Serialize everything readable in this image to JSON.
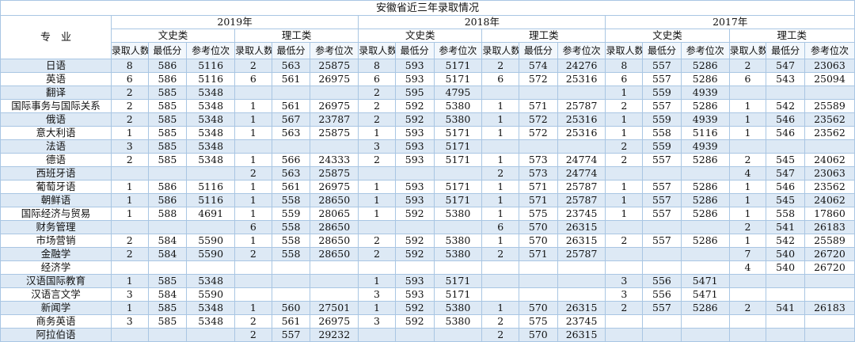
{
  "title": "安徽省近三年录取情况",
  "major_header": "专　业",
  "years": [
    "2019年",
    "2018年",
    "2017年"
  ],
  "tracks": [
    "文史类",
    "理工类"
  ],
  "metrics": [
    "录取人数",
    "最低分",
    "参考位次"
  ],
  "rows": [
    {
      "major": "日语",
      "v": [
        "8",
        "586",
        "5116",
        "2",
        "563",
        "25875",
        "8",
        "593",
        "5171",
        "2",
        "574",
        "24276",
        "8",
        "557",
        "5286",
        "2",
        "547",
        "23063"
      ]
    },
    {
      "major": "英语",
      "v": [
        "6",
        "586",
        "5116",
        "6",
        "561",
        "26975",
        "6",
        "593",
        "5171",
        "6",
        "572",
        "25316",
        "6",
        "557",
        "5286",
        "6",
        "543",
        "25094"
      ]
    },
    {
      "major": "翻译",
      "v": [
        "2",
        "585",
        "5348",
        "",
        "",
        "",
        "2",
        "595",
        "4795",
        "",
        "",
        "",
        "1",
        "559",
        "4939",
        "",
        "",
        ""
      ]
    },
    {
      "major": "国际事务与国际关系",
      "v": [
        "2",
        "585",
        "5348",
        "1",
        "561",
        "26975",
        "2",
        "592",
        "5380",
        "1",
        "571",
        "25787",
        "2",
        "557",
        "5286",
        "1",
        "542",
        "25589"
      ]
    },
    {
      "major": "俄语",
      "v": [
        "2",
        "585",
        "5348",
        "1",
        "567",
        "23787",
        "2",
        "592",
        "5380",
        "1",
        "572",
        "25316",
        "1",
        "559",
        "4939",
        "1",
        "546",
        "23562"
      ]
    },
    {
      "major": "意大利语",
      "v": [
        "1",
        "585",
        "5348",
        "1",
        "563",
        "25875",
        "1",
        "593",
        "5171",
        "1",
        "572",
        "25316",
        "1",
        "558",
        "5116",
        "1",
        "546",
        "23562"
      ]
    },
    {
      "major": "法语",
      "v": [
        "3",
        "585",
        "5348",
        "",
        "",
        "",
        "3",
        "593",
        "5171",
        "",
        "",
        "",
        "2",
        "559",
        "4939",
        "",
        "",
        ""
      ]
    },
    {
      "major": "德语",
      "v": [
        "2",
        "585",
        "5348",
        "1",
        "566",
        "24333",
        "2",
        "593",
        "5171",
        "1",
        "573",
        "24774",
        "2",
        "557",
        "5286",
        "2",
        "545",
        "24062"
      ]
    },
    {
      "major": "西班牙语",
      "v": [
        "",
        "",
        "",
        "2",
        "563",
        "25875",
        "",
        "",
        "",
        "2",
        "573",
        "24774",
        "",
        "",
        "",
        "4",
        "547",
        "23063"
      ]
    },
    {
      "major": "葡萄牙语",
      "v": [
        "1",
        "586",
        "5116",
        "1",
        "561",
        "26975",
        "1",
        "593",
        "5171",
        "1",
        "571",
        "25787",
        "1",
        "557",
        "5286",
        "1",
        "546",
        "23562"
      ]
    },
    {
      "major": "朝鲜语",
      "v": [
        "1",
        "586",
        "5116",
        "1",
        "558",
        "28650",
        "1",
        "593",
        "5171",
        "1",
        "571",
        "25787",
        "1",
        "557",
        "5286",
        "1",
        "545",
        "24062"
      ]
    },
    {
      "major": "国际经济与贸易",
      "v": [
        "1",
        "588",
        "4691",
        "1",
        "559",
        "28065",
        "1",
        "592",
        "5380",
        "1",
        "575",
        "23745",
        "1",
        "557",
        "5286",
        "1",
        "558",
        "17860"
      ]
    },
    {
      "major": "财务管理",
      "v": [
        "",
        "",
        "",
        "6",
        "558",
        "28650",
        "",
        "",
        "",
        "6",
        "570",
        "26315",
        "",
        "",
        "",
        "2",
        "541",
        "26183"
      ]
    },
    {
      "major": "市场营销",
      "v": [
        "2",
        "584",
        "5590",
        "1",
        "558",
        "28650",
        "2",
        "592",
        "5380",
        "1",
        "570",
        "26315",
        "2",
        "557",
        "5286",
        "1",
        "542",
        "25589"
      ]
    },
    {
      "major": "金融学",
      "v": [
        "2",
        "584",
        "5590",
        "2",
        "558",
        "28650",
        "2",
        "592",
        "5380",
        "2",
        "571",
        "25787",
        "",
        "",
        "",
        "7",
        "540",
        "26720"
      ]
    },
    {
      "major": "经济学",
      "v": [
        "",
        "",
        "",
        "",
        "",
        "",
        "",
        "",
        "",
        "",
        "",
        "",
        "",
        "",
        "",
        "4",
        "540",
        "26720"
      ]
    },
    {
      "major": "汉语国际教育",
      "v": [
        "1",
        "585",
        "5348",
        "",
        "",
        "",
        "1",
        "593",
        "5171",
        "",
        "",
        "",
        "3",
        "556",
        "5471",
        "",
        "",
        ""
      ]
    },
    {
      "major": "汉语言文学",
      "v": [
        "3",
        "584",
        "5590",
        "",
        "",
        "",
        "3",
        "593",
        "5171",
        "",
        "",
        "",
        "3",
        "556",
        "5471",
        "",
        "",
        ""
      ]
    },
    {
      "major": "新闻学",
      "v": [
        "1",
        "585",
        "5348",
        "1",
        "560",
        "27501",
        "1",
        "592",
        "5380",
        "1",
        "570",
        "26315",
        "2",
        "557",
        "5286",
        "2",
        "541",
        "26183"
      ]
    },
    {
      "major": "商务英语",
      "v": [
        "3",
        "585",
        "5348",
        "2",
        "561",
        "26975",
        "3",
        "592",
        "5380",
        "2",
        "575",
        "23745",
        "",
        "",
        "",
        "",
        "",
        ""
      ]
    },
    {
      "major": "阿拉伯语",
      "v": [
        "",
        "",
        "",
        "2",
        "557",
        "29232",
        "",
        "",
        "",
        "2",
        "570",
        "26315",
        "",
        "",
        "",
        "",
        "",
        ""
      ]
    }
  ]
}
